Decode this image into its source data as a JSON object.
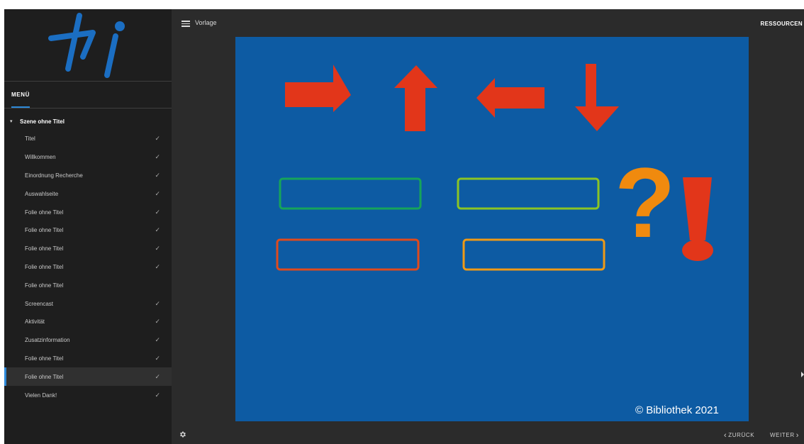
{
  "topbar": {
    "course_title": "Vorlage",
    "resources_label": "RESSOURCEN",
    "menu_icon": "hamburger-icon"
  },
  "sidebar": {
    "menu_label": "MENÜ",
    "scene_title": "Szene ohne Titel",
    "scene_caret_icon": "caret-down-icon",
    "items": [
      {
        "label": "Titel",
        "completed": true,
        "current": false
      },
      {
        "label": "Willkommen",
        "completed": true,
        "current": false
      },
      {
        "label": "Einordnung Recherche",
        "completed": true,
        "current": false
      },
      {
        "label": "Auswahlseite",
        "completed": true,
        "current": false
      },
      {
        "label": "Folie ohne Titel",
        "completed": true,
        "current": false
      },
      {
        "label": "Folie ohne Titel",
        "completed": true,
        "current": false
      },
      {
        "label": "Folie ohne Titel",
        "completed": true,
        "current": false
      },
      {
        "label": "Folie ohne Titel",
        "completed": true,
        "current": false
      },
      {
        "label": "Folie ohne Titel",
        "completed": false,
        "current": false
      },
      {
        "label": "Screencast",
        "completed": true,
        "current": false
      },
      {
        "label": "Aktivität",
        "completed": true,
        "current": false
      },
      {
        "label": "Zusatzinformation",
        "completed": true,
        "current": false
      },
      {
        "label": "Folie ohne Titel",
        "completed": true,
        "current": false
      },
      {
        "label": "Folie ohne Titel",
        "completed": true,
        "current": true
      },
      {
        "label": "Vielen Dank!",
        "completed": true,
        "current": false
      }
    ],
    "check_glyph": "✓"
  },
  "slide": {
    "copyright": "© Bibliothek 2021",
    "background_color": "#0d5ba3",
    "arrow_color": "#e2361a",
    "question_mark": "?",
    "question_color": "#f08a0e",
    "exclamation_color": "#e2361a",
    "arrows": [
      "arrow-right-icon",
      "arrow-up-icon",
      "arrow-left-icon",
      "arrow-down-icon"
    ],
    "boxes": [
      {
        "name": "green-outline-box",
        "color": "#16a45a"
      },
      {
        "name": "lime-outline-box",
        "color": "#8bc424"
      },
      {
        "name": "red-outline-box",
        "color": "#e04a1c"
      },
      {
        "name": "orange-outline-box",
        "color": "#ef9a16"
      }
    ]
  },
  "footer": {
    "prev_label": "ZURÜCK",
    "next_label": "WEITER",
    "settings_icon": "gear-icon"
  },
  "colors": {
    "accent": "#2d89d8",
    "logo_blue": "#1b6ec2",
    "sidebar_bg": "#1e1e1e",
    "app_bg": "#2b2b2b"
  }
}
